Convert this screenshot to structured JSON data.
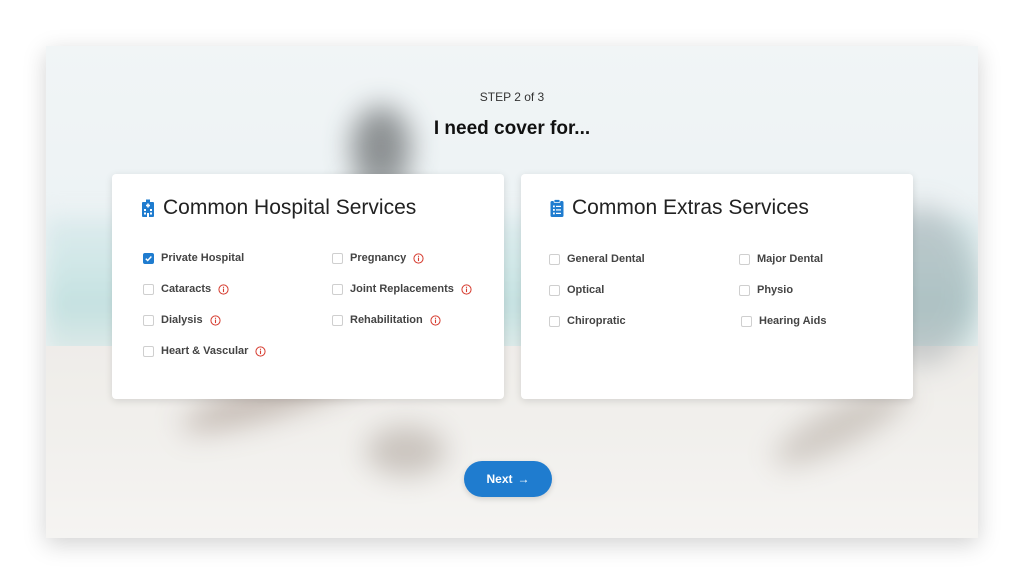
{
  "step_label": "STEP 2 of 3",
  "heading": "I need cover for...",
  "hospital": {
    "title": "Common Hospital Services",
    "options": [
      {
        "label": "Private Hospital",
        "checked": true,
        "info": false
      },
      {
        "label": "Pregnancy",
        "checked": false,
        "info": true
      },
      {
        "label": "Cataracts",
        "checked": false,
        "info": true
      },
      {
        "label": "Joint Replacements",
        "checked": false,
        "info": true
      },
      {
        "label": "Dialysis",
        "checked": false,
        "info": true
      },
      {
        "label": "Rehabilitation",
        "checked": false,
        "info": true
      },
      {
        "label": "Heart & Vascular",
        "checked": false,
        "info": true
      }
    ]
  },
  "extras": {
    "title": "Common Extras Services",
    "options": [
      {
        "label": "General Dental",
        "checked": false
      },
      {
        "label": "Major Dental",
        "checked": false
      },
      {
        "label": "Optical",
        "checked": false
      },
      {
        "label": "Physio",
        "checked": false
      },
      {
        "label": "Chiropratic",
        "checked": false
      },
      {
        "label": "Hearing Aids",
        "checked": false
      }
    ]
  },
  "next_button": {
    "label": "Next",
    "arrow": "→"
  },
  "colors": {
    "accent": "#1f7ccf",
    "info": "#d63b2f"
  },
  "icons": {
    "hospital": "hospital-building-icon",
    "extras": "clipboard-list-icon",
    "info": "info-circle-icon",
    "check": "check-icon"
  }
}
